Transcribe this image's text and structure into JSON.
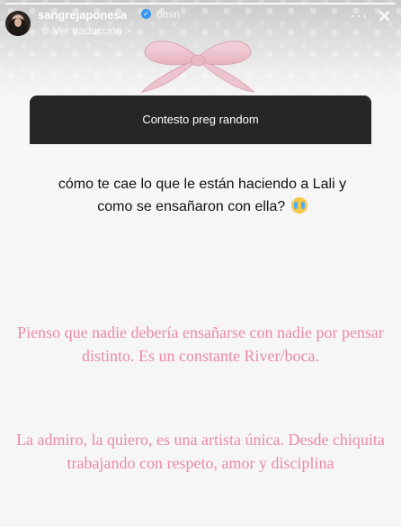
{
  "header": {
    "username": "sangrejaponesa",
    "time": "6min",
    "translate_label": "Ver traducción >",
    "icons": {
      "avatar": "avatar",
      "verified": "verified-badge-icon",
      "more": "more-options-icon",
      "close": "close-icon",
      "globe": "globe-icon"
    }
  },
  "question_card": {
    "header_text": "Contesto preg random",
    "question": "cómo te cae lo que le están haciendo a Lali y como se ensañaron con ella?"
  },
  "answer": {
    "paragraph1": "Pienso que nadie debería ensañarse con nadie por pensar distinto. Es un constante River/boca.",
    "paragraph2": "La admiro, la quiero, es una artista única. Desde chiquita trabajando con respeto, amor y disciplina"
  },
  "colors": {
    "answer_text": "#ea8aa4",
    "card_header_bg": "#262626",
    "verified": "#3897f0"
  }
}
